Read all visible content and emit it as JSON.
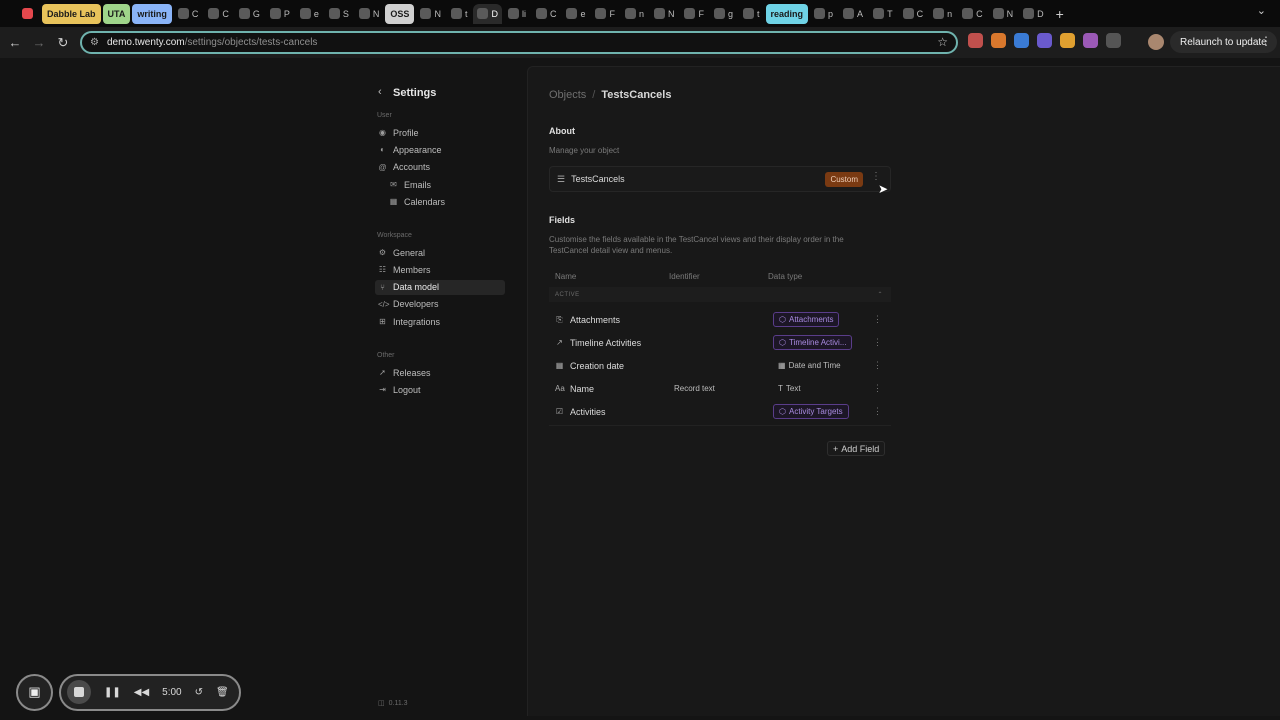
{
  "browser": {
    "tabs": [
      {
        "label": "",
        "color": "#e5484d"
      },
      {
        "label": "Dabble Lab",
        "pill": "#e8c35b"
      },
      {
        "label": "UTA",
        "pill": "#9fd58a"
      },
      {
        "label": "writing",
        "pill": "#8ab4f8"
      },
      {
        "label": "C"
      },
      {
        "label": "C"
      },
      {
        "label": "G"
      },
      {
        "label": "P"
      },
      {
        "label": "e"
      },
      {
        "label": "S"
      },
      {
        "label": "N"
      },
      {
        "label": "OSS",
        "pill": "#d0d0d0"
      },
      {
        "label": "N"
      },
      {
        "label": "t"
      },
      {
        "label": "D",
        "active": true
      },
      {
        "label": "li"
      },
      {
        "label": "C"
      },
      {
        "label": "e"
      },
      {
        "label": "F"
      },
      {
        "label": "n"
      },
      {
        "label": "N"
      },
      {
        "label": "F"
      },
      {
        "label": "g"
      },
      {
        "label": "t"
      },
      {
        "label": "reading",
        "pill": "#6fd3e6"
      },
      {
        "label": "p"
      },
      {
        "label": "A"
      },
      {
        "label": "T"
      },
      {
        "label": "C"
      },
      {
        "label": "n"
      },
      {
        "label": "C"
      },
      {
        "label": "N"
      },
      {
        "label": "D"
      }
    ],
    "url_host": "demo.twenty.com",
    "url_path": "/settings/objects/tests-cancels",
    "relaunch_label": "Relaunch to update"
  },
  "sidebar": {
    "title": "Settings",
    "user_label": "User",
    "user_items": [
      {
        "label": "Profile",
        "icon": "user-circle-icon"
      },
      {
        "label": "Appearance",
        "icon": "palette-icon"
      },
      {
        "label": "Accounts",
        "icon": "at-icon"
      }
    ],
    "user_sub_items": [
      {
        "label": "Emails",
        "icon": "mail-icon"
      },
      {
        "label": "Calendars",
        "icon": "calendar-icon"
      }
    ],
    "workspace_label": "Workspace",
    "workspace_items": [
      {
        "label": "General",
        "icon": "gear-icon"
      },
      {
        "label": "Members",
        "icon": "users-icon"
      },
      {
        "label": "Data model",
        "icon": "hierarchy-icon",
        "active": true
      },
      {
        "label": "Developers",
        "icon": "code-icon"
      },
      {
        "label": "Integrations",
        "icon": "apps-icon"
      }
    ],
    "other_label": "Other",
    "other_items": [
      {
        "label": "Releases",
        "icon": "rocket-icon"
      },
      {
        "label": "Logout",
        "icon": "logout-icon"
      }
    ],
    "version": "0.11.3"
  },
  "main": {
    "breadcrumb_parent": "Objects",
    "breadcrumb_sep": "/",
    "breadcrumb_current": "TestsCancels",
    "about_title": "About",
    "about_desc": "Manage your object",
    "object_name": "TestsCancels",
    "object_badge": "Custom",
    "fields_title": "Fields",
    "fields_desc": "Customise the fields available in the TestCancel views and their display order in the TestCancel detail view and menus.",
    "columns": {
      "name": "Name",
      "identifier": "Identifier",
      "data_type": "Data type"
    },
    "group_label": "ACTIVE",
    "rows": [
      {
        "name": "Attachments",
        "identifier": "",
        "type": "Attachments",
        "type_style": "rel",
        "icon": "file-import-icon"
      },
      {
        "name": "Timeline Activities",
        "identifier": "",
        "type": "Timeline Activi...",
        "type_style": "rel",
        "icon": "timeline-icon"
      },
      {
        "name": "Creation date",
        "identifier": "",
        "type": "Date and Time",
        "type_style": "plain",
        "icon": "calendar-icon"
      },
      {
        "name": "Name",
        "identifier": "Record text",
        "type": "Text",
        "type_style": "plain",
        "icon": "abc-icon"
      },
      {
        "name": "Activities",
        "identifier": "",
        "type": "Activity Targets",
        "type_style": "rel",
        "icon": "checkbox-icon"
      }
    ],
    "add_field_label": "Add Field"
  },
  "recorder": {
    "time": "5:00"
  }
}
